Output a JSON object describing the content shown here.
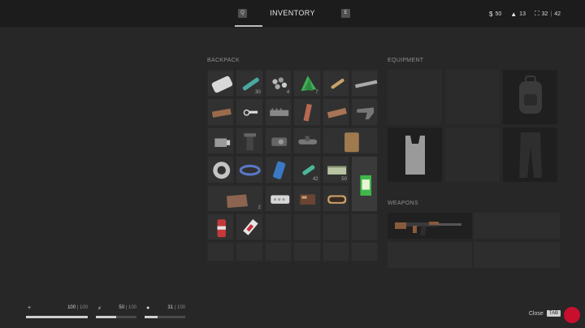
{
  "header": {
    "key_left": "Q",
    "title": "INVENTORY",
    "key_right": "E",
    "money": "50",
    "weight": "13",
    "slots_used": "32",
    "slots_total": "42",
    "slot_separator": "|"
  },
  "backpack": {
    "label": "BACKPACK",
    "items": [
      {
        "name": "bandage-roll-icon",
        "count": ""
      },
      {
        "name": "rifle-ammo-icon",
        "count": "30"
      },
      {
        "name": "scrap-parts-icon",
        "count": "4"
      },
      {
        "name": "herbs-icon",
        "count": "7"
      },
      {
        "name": "bullet-icon",
        "count": ""
      },
      {
        "name": "barrel-icon",
        "count": ""
      },
      {
        "name": "handguard-icon",
        "count": ""
      },
      {
        "name": "keychain-icon",
        "count": ""
      },
      {
        "name": "rail-icon",
        "count": ""
      },
      {
        "name": "grip-icon",
        "count": ""
      },
      {
        "name": "wood-stock-icon",
        "count": ""
      },
      {
        "name": "stock-icon",
        "count": ""
      },
      {
        "name": "lamp-icon",
        "count": ""
      },
      {
        "name": "magazine-icon",
        "count": ""
      },
      {
        "name": "red-dot-sight-icon",
        "count": ""
      },
      {
        "name": "scope-icon",
        "count": ""
      },
      {
        "name": "backpack-pouch-icon",
        "count": ""
      },
      {
        "name": "duct-tape-icon",
        "count": ""
      },
      {
        "name": "belt-icon",
        "count": ""
      },
      {
        "name": "phone-icon",
        "count": ""
      },
      {
        "name": "shotgun-shell-icon",
        "count": "42"
      },
      {
        "name": "cash-icon",
        "count": "50"
      },
      {
        "name": "juice-carton-icon",
        "count": ""
      },
      {
        "name": "cloth-icon",
        "count": "2"
      },
      {
        "name": "pills-icon",
        "count": ""
      },
      {
        "name": "chocolate-icon",
        "count": ""
      },
      {
        "name": "sardine-can-icon",
        "count": ""
      },
      {
        "name": "soda-can-icon",
        "count": ""
      },
      {
        "name": "energy-bar-icon",
        "count": ""
      }
    ]
  },
  "equipment": {
    "label": "EQUIPMENT",
    "slots": [
      {
        "name": "head-slot",
        "item": ""
      },
      {
        "name": "armor-slot",
        "item": ""
      },
      {
        "name": "backpack-slot",
        "item": "backpack-icon"
      },
      {
        "name": "shirt-slot",
        "item": "tank-top-icon"
      },
      {
        "name": "jacket-slot",
        "item": ""
      },
      {
        "name": "pants-slot",
        "item": "pants-icon"
      }
    ]
  },
  "weapons": {
    "label": "WEAPONS",
    "slots": [
      {
        "name": "primary-weapon-slot",
        "item": "assault-rifle-icon"
      },
      {
        "name": "secondary-weapon-slot",
        "item": ""
      },
      {
        "name": "sidearm-slot",
        "item": ""
      },
      {
        "name": "melee-slot",
        "item": ""
      }
    ]
  },
  "vitals": [
    {
      "name": "health",
      "icon": "+",
      "value": "100",
      "max": "100",
      "fraction": 1.0
    },
    {
      "name": "energy",
      "icon": "⚡",
      "value": "50",
      "max": "100",
      "fraction": 0.5
    },
    {
      "name": "hydration",
      "icon": "💧",
      "value": "31",
      "max": "100",
      "fraction": 0.31
    }
  ],
  "footer": {
    "close_label": "Close",
    "close_key": "TAB"
  },
  "colors": {
    "background": "#272727",
    "topbar": "#1c1c1c",
    "logo": "#c8102e"
  }
}
